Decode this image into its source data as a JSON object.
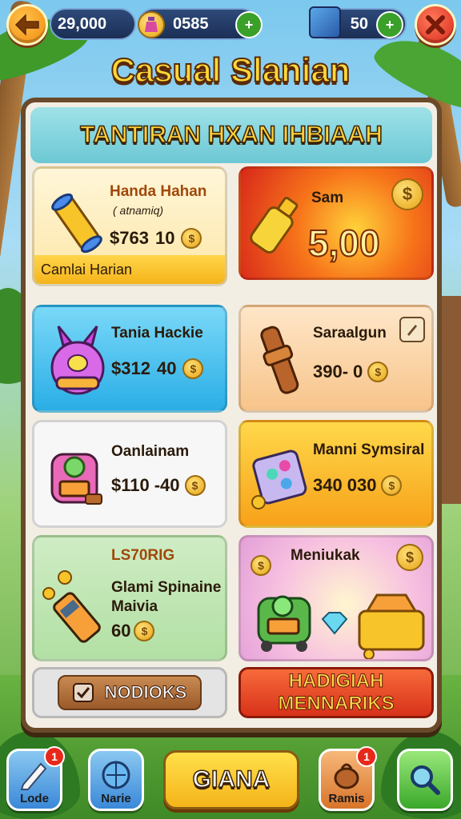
{
  "topbar": {
    "coins": "29,000",
    "gems": "0585",
    "energy": "50"
  },
  "title": "Casual Slanian",
  "panel": {
    "header": "TANTIRAN HXAN IHBIAAH",
    "cards": [
      {
        "name": "Handa Hahan",
        "sub": "( atnamiq)",
        "price": "$763",
        "cost": "10",
        "footer": "Camlai Harian"
      },
      {
        "name": "Sam",
        "price": "5,00"
      },
      {
        "name": "Tania Hackie",
        "price": "$312",
        "cost": "40"
      },
      {
        "name": "Saraalgun",
        "price": "390-",
        "cost": "0"
      },
      {
        "name": "Oanlainam",
        "price": "$110",
        "cost": "-40"
      },
      {
        "name": "Manni Symsiral",
        "price": "340",
        "cost": "030"
      },
      {
        "tag": "LS70RIG",
        "name": "Glami Spinaine",
        "name2": "Maivia",
        "cost": "60"
      },
      {
        "name": "Meniukak"
      }
    ],
    "left_button": "NODIOKS",
    "right_button_line1": "HADIGIAH",
    "right_button_line2": "MENNARIKS"
  },
  "nav": {
    "item1": {
      "label": "Lode",
      "badge": "1"
    },
    "item2": {
      "label": "Narie"
    },
    "center": "GIANA",
    "item4": {
      "label": "Ramis",
      "badge": "1"
    },
    "item5": {
      "label": ""
    }
  }
}
